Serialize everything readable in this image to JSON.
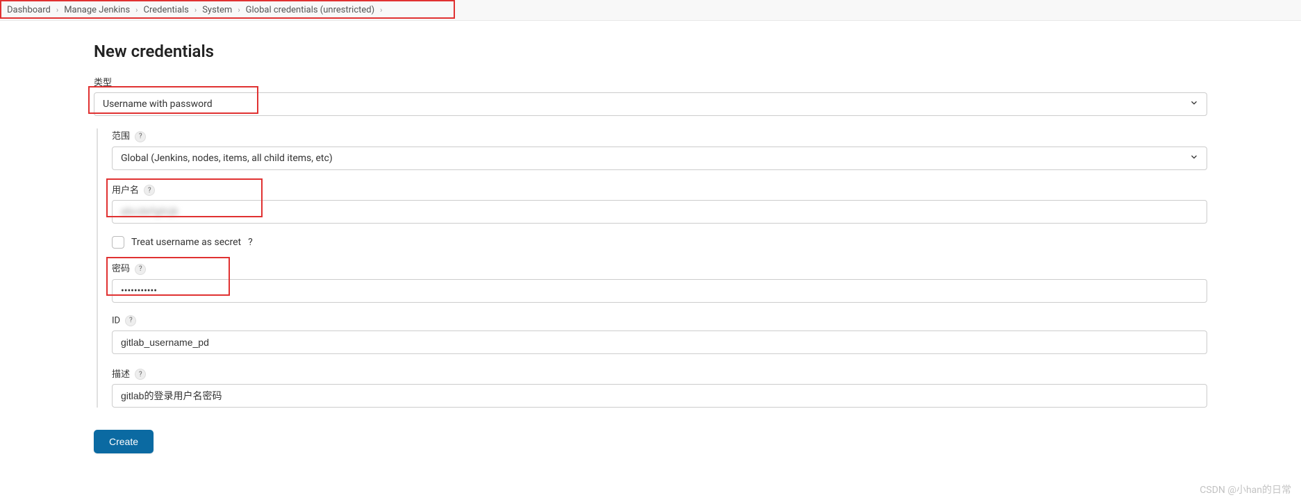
{
  "breadcrumb": {
    "items": [
      "Dashboard",
      "Manage Jenkins",
      "Credentials",
      "System",
      "Global credentials (unrestricted)"
    ]
  },
  "page": {
    "title": "New credentials"
  },
  "form": {
    "type": {
      "label": "类型",
      "value": "Username with password"
    },
    "scope": {
      "label": "范围",
      "value": "Global (Jenkins, nodes, items, all child items, etc)"
    },
    "username": {
      "label": "用户名",
      "value": "abcdefghijk"
    },
    "treatSecret": {
      "label": "Treat username as secret",
      "checked": false
    },
    "password": {
      "label": "密码",
      "value": "•••••••••••"
    },
    "id": {
      "label": "ID",
      "value": "gitlab_username_pd"
    },
    "description": {
      "label": "描述",
      "value": "gitlab的登录用户名密码"
    },
    "createButton": "Create"
  },
  "watermark": "CSDN @小han的日常"
}
